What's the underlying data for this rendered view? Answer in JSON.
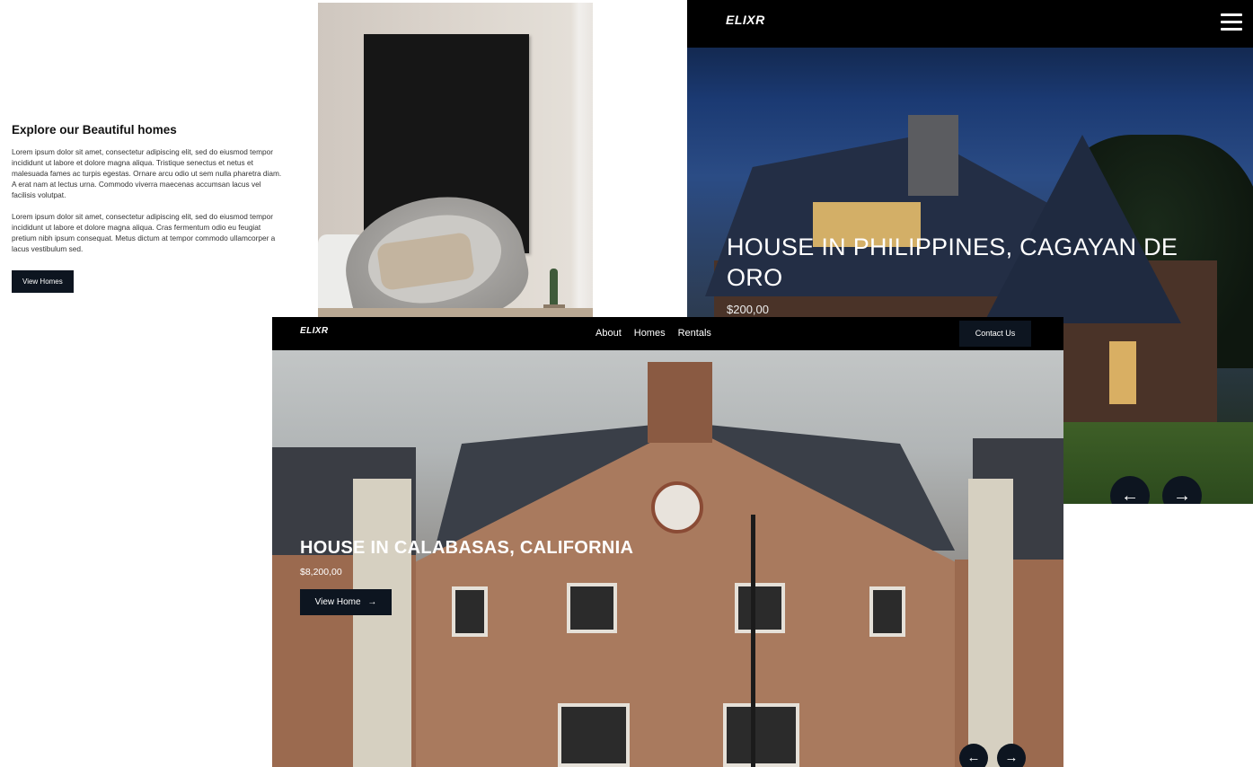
{
  "explore": {
    "title": "Explore our Beautiful homes",
    "paragraph1": "Lorem ipsum dolor sit amet, consectetur adipiscing elit, sed do eiusmod tempor incididunt ut labore et dolore magna aliqua. Tristique senectus et netus et malesuada fames ac turpis egestas. Ornare arcu odio ut sem nulla pharetra diam. A erat nam at lectus urna. Commodo viverra maecenas accumsan lacus vel facilisis volutpat.",
    "paragraph2": "Lorem ipsum dolor sit amet, consectetur adipiscing elit, sed do eiusmod tempor incididunt ut labore et dolore magna aliqua. Cras fermentum odio eu feugiat pretium nibh ipsum consequat. Metus dictum at tempor commodo ullamcorper a lacus vestibulum sed.",
    "button_label": "View Homes"
  },
  "hero_philippines": {
    "logo": "ELIXR",
    "menu_icon": "hamburger-menu-icon",
    "title": "HOUSE IN PHILIPPINES, CAGAYAN DE ORO",
    "price": "$200,00",
    "prev_icon": "arrow-left-icon",
    "next_icon": "arrow-right-icon"
  },
  "hero_calabasas": {
    "logo": "ELIXR",
    "nav": {
      "about": "About",
      "homes": "Homes",
      "rentals": "Rentals",
      "contact": "Contact Us"
    },
    "title": "HOUSE IN CALABASAS, CALIFORNIA",
    "price": "$8,200,00",
    "button_label": "View Home",
    "button_icon": "arrow-right-icon",
    "prev_icon": "arrow-left-icon",
    "next_icon": "arrow-right-icon"
  },
  "colors": {
    "accent_dark": "#0d1520",
    "nav_bg": "#000000",
    "text_light": "#ffffff"
  }
}
